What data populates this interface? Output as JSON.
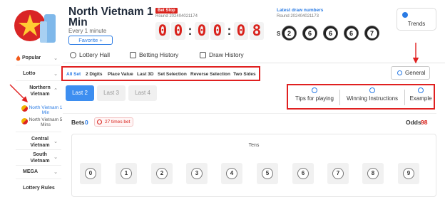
{
  "header": {
    "title": "North Vietnam 1 Min",
    "subtitle": "Every 1 minute",
    "favorite_label": "Favorite +",
    "status_badge": "Bet Stop",
    "current_round": "Round 202404021174",
    "timer_digits": [
      "0",
      "0",
      "0",
      "0",
      "0",
      "8"
    ],
    "latest_label": "Latest draw numbers",
    "latest_round": "Round 202404021173",
    "result_prefix": "S",
    "result_balls": [
      "2",
      "6",
      "6",
      "6",
      "7"
    ],
    "trends_label": "Trends"
  },
  "sidebar": {
    "items": [
      {
        "label": "Popular"
      },
      {
        "label": "Lotto"
      },
      {
        "label": "Northern Vietnam"
      },
      {
        "label": "Central Vietnam"
      },
      {
        "label": "South Vietnam"
      },
      {
        "label": "MEGA"
      },
      {
        "label": "Lottery Rules"
      }
    ],
    "sub_items": [
      {
        "label": "North Vietnam 1 Min",
        "active": true
      },
      {
        "label": "North Vietnam 5 Mins",
        "active": false
      }
    ]
  },
  "nav": {
    "tabs": [
      {
        "label": "Lottery Hall",
        "icon": "target-icon"
      },
      {
        "label": "Betting History",
        "icon": "document-icon"
      },
      {
        "label": "Draw History",
        "icon": "chart-icon"
      }
    ]
  },
  "subtabs": [
    "All Set",
    "2 Digits",
    "Place Value",
    "Last 3D",
    "Set Selection",
    "Reverse Selection",
    "Two Sides"
  ],
  "general_label": "General",
  "last_buttons": [
    "Last 2",
    "Last 3",
    "Last 4"
  ],
  "tips": [
    "Tips for playing",
    "Winning Instructions",
    "Example"
  ],
  "bets": {
    "label": "Bets",
    "value": "0",
    "times_text": "27 times bet",
    "odds_label": "Odds",
    "odds_value": "98"
  },
  "tens": {
    "title": "Tens",
    "numbers": [
      "0",
      "1",
      "2",
      "3",
      "4",
      "5",
      "6",
      "7",
      "8",
      "9"
    ]
  },
  "colors": {
    "accent": "#2a7be4",
    "danger": "#d9221c",
    "annotation": "#e02020"
  }
}
